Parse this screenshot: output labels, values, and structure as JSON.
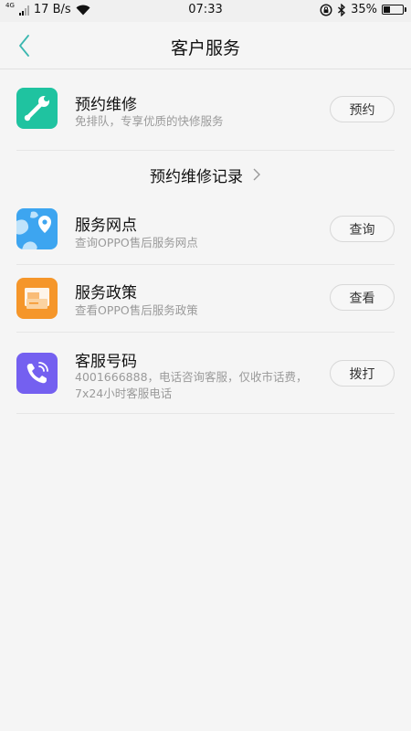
{
  "status_bar": {
    "network_type": "4G",
    "speed": "17 B/s",
    "time": "07:33",
    "battery_percent": "35%",
    "battery_level": 0.35
  },
  "header": {
    "title": "客户服务",
    "back_icon": "chevron-left-icon",
    "accent": "#3bb7b0"
  },
  "repair": {
    "title": "预约维修",
    "subtitle": "免排队，专享优质的快修服务",
    "button": "预约",
    "icon": "wrench-icon",
    "color": "#1fc3a0"
  },
  "records": {
    "label": "预约维修记录",
    "icon": "chevron-right-icon"
  },
  "service_points": {
    "title": "服务网点",
    "subtitle": "查询OPPO售后服务网点",
    "button": "查询",
    "icon": "map-pin-icon",
    "color": "#3da5f0"
  },
  "policy": {
    "title": "服务政策",
    "subtitle": "查看OPPO售后服务政策",
    "button": "查看",
    "icon": "document-icon",
    "color": "#f5962a"
  },
  "hotline": {
    "title": "客服号码",
    "subtitle_line1": "4001666888，电话咨询客服，仅收市话费，",
    "subtitle_line2": "7x24小时客服电话",
    "button": "拨打",
    "icon": "phone-icon",
    "color": "#7460f0"
  }
}
